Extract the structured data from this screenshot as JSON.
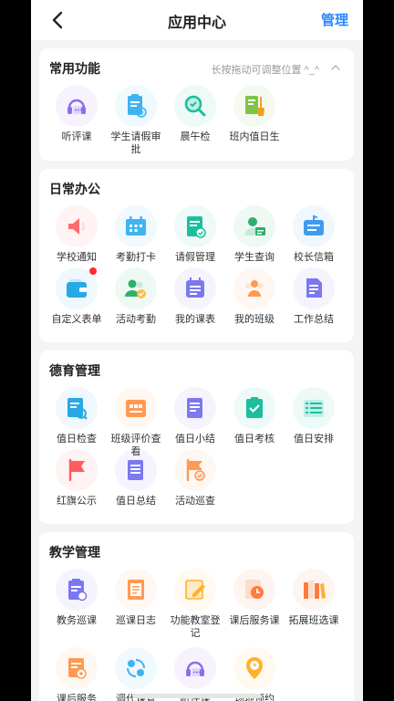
{
  "header": {
    "title": "应用中心",
    "action_label": "管理",
    "back_icon": "back-arrow-icon"
  },
  "sections": [
    {
      "title": "常用功能",
      "hint": "长按拖动可调整位置 ^_^",
      "items": [
        {
          "label": "听评课",
          "icon": "headset-chat-icon",
          "color": "#8c6cf0"
        },
        {
          "label": "学生请假审批",
          "icon": "leave-approval-icon",
          "color": "#3fb4f0"
        },
        {
          "label": "晨午检",
          "icon": "magnifier-check-icon",
          "color": "#1bbf9e"
        },
        {
          "label": "班内值日生",
          "icon": "broom-icon",
          "color": "#7ec446"
        }
      ]
    },
    {
      "title": "日常办公",
      "items": [
        {
          "label": "学校通知",
          "icon": "speaker-icon",
          "color": "#ff6b6b"
        },
        {
          "label": "考勤打卡",
          "icon": "calendar-icon",
          "color": "#3fb4f0"
        },
        {
          "label": "请假管理",
          "icon": "document-edit-icon",
          "color": "#1bbf9e"
        },
        {
          "label": "学生查询",
          "icon": "student-card-icon",
          "color": "#2fae6e"
        },
        {
          "label": "校长信箱",
          "icon": "mailbox-icon",
          "color": "#3e9cf0"
        },
        {
          "label": "自定义表单",
          "icon": "wallet-icon",
          "color": "#29a8e8",
          "badge": true
        },
        {
          "label": "活动考勤",
          "icon": "people-check-icon",
          "color": "#2fae6e"
        },
        {
          "label": "我的课表",
          "icon": "schedule-icon",
          "color": "#7b78f0"
        },
        {
          "label": "我的班级",
          "icon": "group-icon",
          "color": "#ff9a52"
        },
        {
          "label": "工作总结",
          "icon": "summary-doc-icon",
          "color": "#7b78f0"
        }
      ]
    },
    {
      "title": "德育管理",
      "items": [
        {
          "label": "值日检查",
          "icon": "duty-check-icon",
          "color": "#29a8e8"
        },
        {
          "label": "班级评价查看",
          "icon": "class-rating-icon",
          "color": "#ff9a52"
        },
        {
          "label": "值日小结",
          "icon": "note-icon",
          "color": "#7b78f0"
        },
        {
          "label": "值日考核",
          "icon": "clipboard-check-icon",
          "color": "#1bbf9e"
        },
        {
          "label": "值日安排",
          "icon": "list-icon",
          "color": "#1bbf9e"
        },
        {
          "label": "红旗公示",
          "icon": "red-flag-icon",
          "color": "#ff5c5c"
        },
        {
          "label": "值日总结",
          "icon": "doc-lines-icon",
          "color": "#7b78f0"
        },
        {
          "label": "活动巡查",
          "icon": "flag-check-icon",
          "color": "#ff9a52"
        }
      ]
    },
    {
      "title": "教学管理",
      "items": [
        {
          "label": "教务巡课",
          "icon": "clipboard-patrol-icon",
          "color": "#7b78f0"
        },
        {
          "label": "巡课日志",
          "icon": "log-book-icon",
          "color": "#ff9a52"
        },
        {
          "label": "功能教室登记",
          "icon": "pencil-note-icon",
          "color": "#ffb12e"
        },
        {
          "label": "课后服务课",
          "icon": "clock-doc-icon",
          "color": "#ff7a3c"
        },
        {
          "label": "拓展班选课",
          "icon": "books-icon",
          "color": "#ff7a3c"
        },
        {
          "label": "课后服务",
          "icon": "service-doc-icon",
          "color": "#ff9a52"
        },
        {
          "label": "调代课管",
          "icon": "swap-icon",
          "color": "#3fb4f0"
        },
        {
          "label": "听评课",
          "icon": "headset-chat-icon",
          "color": "#8c6cf0"
        },
        {
          "label": "场地预约",
          "icon": "location-clock-icon",
          "color": "#ffb12e"
        }
      ]
    }
  ]
}
